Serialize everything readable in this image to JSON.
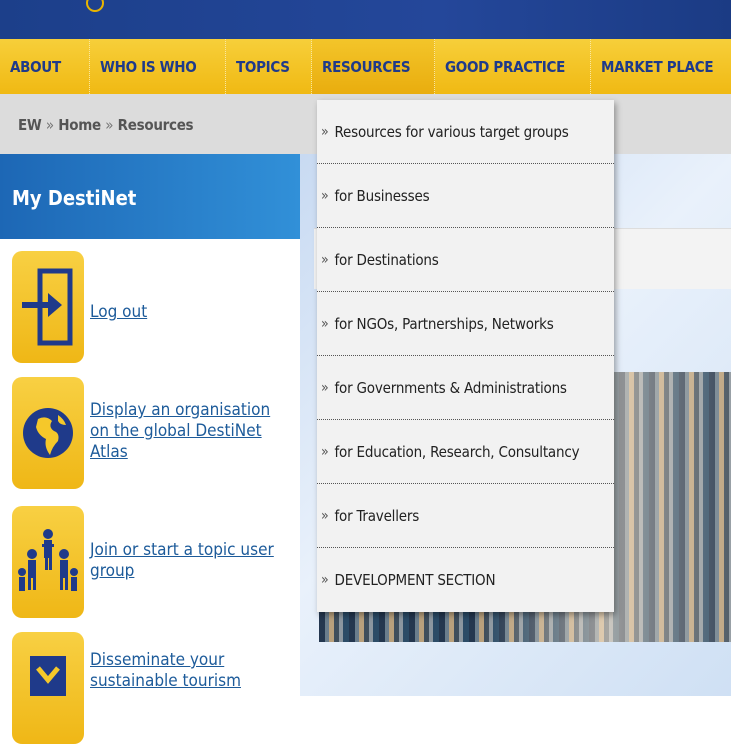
{
  "nav": {
    "items": [
      {
        "label": "ABOUT"
      },
      {
        "label": "WHO IS WHO"
      },
      {
        "label": "TOPICS"
      },
      {
        "label": "RESOURCES"
      },
      {
        "label": "GOOD PRACTICE"
      },
      {
        "label": "MARKET PLACE"
      }
    ]
  },
  "breadcrumb": {
    "items": [
      "EW",
      "Home",
      "Resources"
    ],
    "separator": "»"
  },
  "sidebar": {
    "title": "My DestiNet",
    "actions": [
      {
        "label": "Log out",
        "icon": "logout-icon"
      },
      {
        "label": "Display an organisation on the global DestiNet Atlas",
        "icon": "globe-icon"
      },
      {
        "label": "Join or start a topic user group",
        "icon": "people-group-icon"
      },
      {
        "label": "Disseminate your sustainable tourism",
        "icon": "disseminate-icon"
      }
    ]
  },
  "dropdown": {
    "marker": "»",
    "items": [
      {
        "label": "Resources for various target groups"
      },
      {
        "label": "for Businesses"
      },
      {
        "label": "for Destinations"
      },
      {
        "label": "for NGOs, Partnerships, Networks"
      },
      {
        "label": "for Governments & Administrations"
      },
      {
        "label": "for Education, Research, Consultancy"
      },
      {
        "label": "for Travellers"
      },
      {
        "label": "DEVELOPMENT SECTION"
      }
    ]
  },
  "colors": {
    "nav_bg": "#f2bf1e",
    "nav_text": "#1f3a8a",
    "top_strip": "#1f4290",
    "sidebar_header": "#2a82cf",
    "link": "#1d5b9a"
  }
}
